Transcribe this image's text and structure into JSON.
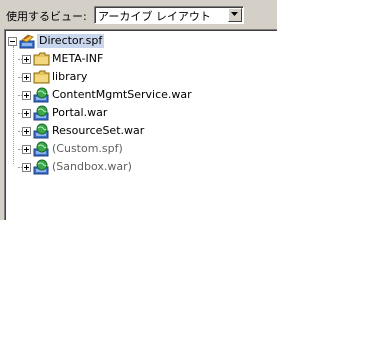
{
  "view_selector": {
    "label": "使用するビュー:",
    "selected": "アーカイブ レイアウト"
  },
  "tree": {
    "root": {
      "label": "Director.spf",
      "icon": "project-icon"
    },
    "children": [
      {
        "label": "META-INF",
        "icon": "folder-icon",
        "dim": false
      },
      {
        "label": "library",
        "icon": "folder-icon",
        "dim": false
      },
      {
        "label": "ContentMgmtService.war",
        "icon": "war-globe-icon",
        "dim": false
      },
      {
        "label": "Portal.war",
        "icon": "war-globe-icon",
        "dim": false
      },
      {
        "label": "ResourceSet.war",
        "icon": "war-globe-icon",
        "dim": false
      },
      {
        "label": "(Custom.spf)",
        "icon": "war-globe-icon",
        "dim": true
      },
      {
        "label": "(Sandbox.war)",
        "icon": "war-globe-icon",
        "dim": true
      }
    ]
  }
}
